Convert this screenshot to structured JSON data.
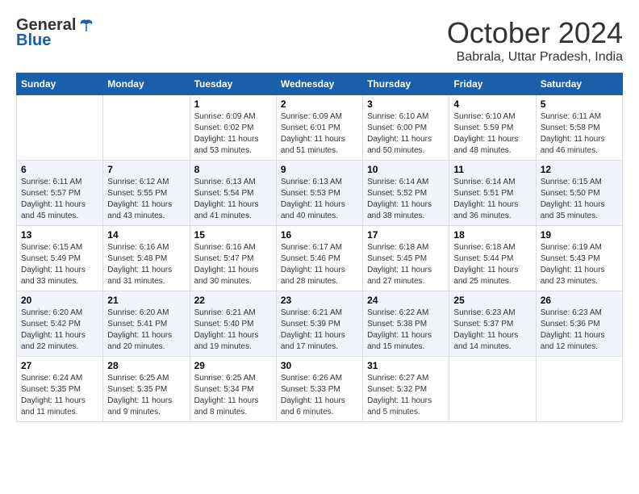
{
  "header": {
    "logo_general": "General",
    "logo_blue": "Blue",
    "month": "October 2024",
    "location": "Babrala, Uttar Pradesh, India"
  },
  "weekdays": [
    "Sunday",
    "Monday",
    "Tuesday",
    "Wednesday",
    "Thursday",
    "Friday",
    "Saturday"
  ],
  "weeks": [
    [
      {
        "day": "",
        "sunrise": "",
        "sunset": "",
        "daylight": ""
      },
      {
        "day": "",
        "sunrise": "",
        "sunset": "",
        "daylight": ""
      },
      {
        "day": "1",
        "sunrise": "Sunrise: 6:09 AM",
        "sunset": "Sunset: 6:02 PM",
        "daylight": "Daylight: 11 hours and 53 minutes."
      },
      {
        "day": "2",
        "sunrise": "Sunrise: 6:09 AM",
        "sunset": "Sunset: 6:01 PM",
        "daylight": "Daylight: 11 hours and 51 minutes."
      },
      {
        "day": "3",
        "sunrise": "Sunrise: 6:10 AM",
        "sunset": "Sunset: 6:00 PM",
        "daylight": "Daylight: 11 hours and 50 minutes."
      },
      {
        "day": "4",
        "sunrise": "Sunrise: 6:10 AM",
        "sunset": "Sunset: 5:59 PM",
        "daylight": "Daylight: 11 hours and 48 minutes."
      },
      {
        "day": "5",
        "sunrise": "Sunrise: 6:11 AM",
        "sunset": "Sunset: 5:58 PM",
        "daylight": "Daylight: 11 hours and 46 minutes."
      }
    ],
    [
      {
        "day": "6",
        "sunrise": "Sunrise: 6:11 AM",
        "sunset": "Sunset: 5:57 PM",
        "daylight": "Daylight: 11 hours and 45 minutes."
      },
      {
        "day": "7",
        "sunrise": "Sunrise: 6:12 AM",
        "sunset": "Sunset: 5:55 PM",
        "daylight": "Daylight: 11 hours and 43 minutes."
      },
      {
        "day": "8",
        "sunrise": "Sunrise: 6:13 AM",
        "sunset": "Sunset: 5:54 PM",
        "daylight": "Daylight: 11 hours and 41 minutes."
      },
      {
        "day": "9",
        "sunrise": "Sunrise: 6:13 AM",
        "sunset": "Sunset: 5:53 PM",
        "daylight": "Daylight: 11 hours and 40 minutes."
      },
      {
        "day": "10",
        "sunrise": "Sunrise: 6:14 AM",
        "sunset": "Sunset: 5:52 PM",
        "daylight": "Daylight: 11 hours and 38 minutes."
      },
      {
        "day": "11",
        "sunrise": "Sunrise: 6:14 AM",
        "sunset": "Sunset: 5:51 PM",
        "daylight": "Daylight: 11 hours and 36 minutes."
      },
      {
        "day": "12",
        "sunrise": "Sunrise: 6:15 AM",
        "sunset": "Sunset: 5:50 PM",
        "daylight": "Daylight: 11 hours and 35 minutes."
      }
    ],
    [
      {
        "day": "13",
        "sunrise": "Sunrise: 6:15 AM",
        "sunset": "Sunset: 5:49 PM",
        "daylight": "Daylight: 11 hours and 33 minutes."
      },
      {
        "day": "14",
        "sunrise": "Sunrise: 6:16 AM",
        "sunset": "Sunset: 5:48 PM",
        "daylight": "Daylight: 11 hours and 31 minutes."
      },
      {
        "day": "15",
        "sunrise": "Sunrise: 6:16 AM",
        "sunset": "Sunset: 5:47 PM",
        "daylight": "Daylight: 11 hours and 30 minutes."
      },
      {
        "day": "16",
        "sunrise": "Sunrise: 6:17 AM",
        "sunset": "Sunset: 5:46 PM",
        "daylight": "Daylight: 11 hours and 28 minutes."
      },
      {
        "day": "17",
        "sunrise": "Sunrise: 6:18 AM",
        "sunset": "Sunset: 5:45 PM",
        "daylight": "Daylight: 11 hours and 27 minutes."
      },
      {
        "day": "18",
        "sunrise": "Sunrise: 6:18 AM",
        "sunset": "Sunset: 5:44 PM",
        "daylight": "Daylight: 11 hours and 25 minutes."
      },
      {
        "day": "19",
        "sunrise": "Sunrise: 6:19 AM",
        "sunset": "Sunset: 5:43 PM",
        "daylight": "Daylight: 11 hours and 23 minutes."
      }
    ],
    [
      {
        "day": "20",
        "sunrise": "Sunrise: 6:20 AM",
        "sunset": "Sunset: 5:42 PM",
        "daylight": "Daylight: 11 hours and 22 minutes."
      },
      {
        "day": "21",
        "sunrise": "Sunrise: 6:20 AM",
        "sunset": "Sunset: 5:41 PM",
        "daylight": "Daylight: 11 hours and 20 minutes."
      },
      {
        "day": "22",
        "sunrise": "Sunrise: 6:21 AM",
        "sunset": "Sunset: 5:40 PM",
        "daylight": "Daylight: 11 hours and 19 minutes."
      },
      {
        "day": "23",
        "sunrise": "Sunrise: 6:21 AM",
        "sunset": "Sunset: 5:39 PM",
        "daylight": "Daylight: 11 hours and 17 minutes."
      },
      {
        "day": "24",
        "sunrise": "Sunrise: 6:22 AM",
        "sunset": "Sunset: 5:38 PM",
        "daylight": "Daylight: 11 hours and 15 minutes."
      },
      {
        "day": "25",
        "sunrise": "Sunrise: 6:23 AM",
        "sunset": "Sunset: 5:37 PM",
        "daylight": "Daylight: 11 hours and 14 minutes."
      },
      {
        "day": "26",
        "sunrise": "Sunrise: 6:23 AM",
        "sunset": "Sunset: 5:36 PM",
        "daylight": "Daylight: 11 hours and 12 minutes."
      }
    ],
    [
      {
        "day": "27",
        "sunrise": "Sunrise: 6:24 AM",
        "sunset": "Sunset: 5:35 PM",
        "daylight": "Daylight: 11 hours and 11 minutes."
      },
      {
        "day": "28",
        "sunrise": "Sunrise: 6:25 AM",
        "sunset": "Sunset: 5:35 PM",
        "daylight": "Daylight: 11 hours and 9 minutes."
      },
      {
        "day": "29",
        "sunrise": "Sunrise: 6:25 AM",
        "sunset": "Sunset: 5:34 PM",
        "daylight": "Daylight: 11 hours and 8 minutes."
      },
      {
        "day": "30",
        "sunrise": "Sunrise: 6:26 AM",
        "sunset": "Sunset: 5:33 PM",
        "daylight": "Daylight: 11 hours and 6 minutes."
      },
      {
        "day": "31",
        "sunrise": "Sunrise: 6:27 AM",
        "sunset": "Sunset: 5:32 PM",
        "daylight": "Daylight: 11 hours and 5 minutes."
      },
      {
        "day": "",
        "sunrise": "",
        "sunset": "",
        "daylight": ""
      },
      {
        "day": "",
        "sunrise": "",
        "sunset": "",
        "daylight": ""
      }
    ]
  ]
}
